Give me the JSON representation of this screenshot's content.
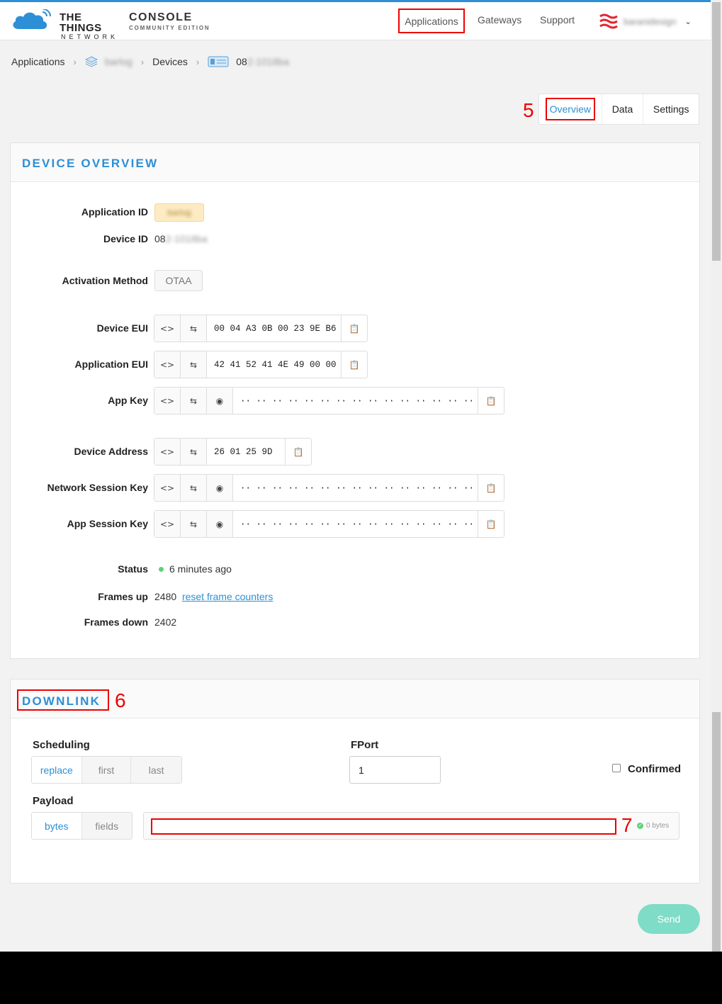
{
  "header": {
    "logo_line1": "THE THINGS",
    "logo_line2": "NETWORK",
    "console_title": "CONSOLE",
    "console_subtitle": "COMMUNITY EDITION",
    "nav": {
      "applications": "Applications",
      "gateways": "Gateways",
      "support": "Support"
    },
    "user_name": "baranidesign"
  },
  "breadcrumb": {
    "applications": "Applications",
    "app_name": "barlog",
    "devices": "Devices",
    "device_prefix": "08",
    "device_blurred": "2-1018ba"
  },
  "tabs": {
    "overview": "Overview",
    "data": "Data",
    "settings": "Settings"
  },
  "annotations": {
    "label5": "5",
    "label6": "6",
    "label7": "7"
  },
  "device_overview": {
    "title": "DEVICE OVERVIEW",
    "application_id_label": "Application ID",
    "application_id_value": "barlog",
    "device_id_label": "Device ID",
    "device_id_prefix": "08",
    "device_id_blurred": "2-1018ba",
    "activation_method_label": "Activation Method",
    "activation_method_value": "OTAA",
    "device_eui_label": "Device EUI",
    "device_eui_value": "00 04 A3 0B 00 23 9E B6",
    "application_eui_label": "Application EUI",
    "application_eui_value": "42 41 52 41 4E 49 00 00",
    "app_key_label": "App Key",
    "app_key_value": "·· ·· ·· ·· ·· ·· ·· ·· ·· ·· ·· ·· ·· ·· ·· ··",
    "device_address_label": "Device Address",
    "device_address_value": "26 01 25 9D",
    "network_session_key_label": "Network Session Key",
    "network_session_key_value": "·· ·· ·· ·· ·· ·· ·· ·· ·· ·· ·· ·· ·· ·· ·· ··",
    "app_session_key_label": "App Session Key",
    "app_session_key_value": "·· ·· ·· ·· ·· ·· ·· ·· ·· ·· ·· ·· ·· ·· ·· ··",
    "status_label": "Status",
    "status_value": "6 minutes ago",
    "frames_up_label": "Frames up",
    "frames_up_value": "2480",
    "reset_link": "reset frame counters",
    "frames_down_label": "Frames down",
    "frames_down_value": "2402"
  },
  "downlink": {
    "title": "DOWNLINK",
    "scheduling_label": "Scheduling",
    "scheduling_options": [
      "replace",
      "first",
      "last"
    ],
    "fport_label": "FPort",
    "fport_value": "1",
    "confirmed_label": "Confirmed",
    "payload_label": "Payload",
    "payload_modes": [
      "bytes",
      "fields"
    ],
    "payload_size": "0 bytes",
    "send_label": "Send"
  },
  "colors": {
    "accent": "#2d8fd5",
    "annotation": "#ee0000",
    "send": "#7fdcc6",
    "status_ok": "#5ed37a"
  }
}
